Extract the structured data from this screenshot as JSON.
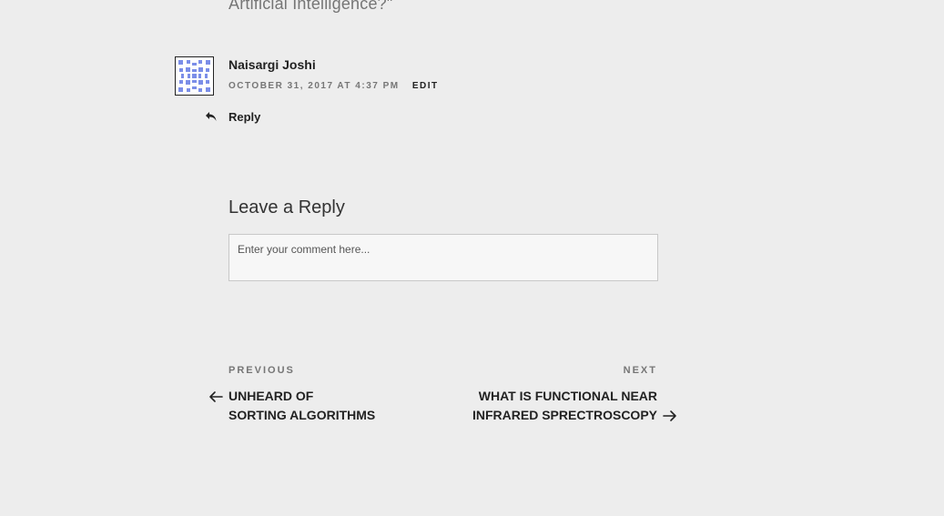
{
  "previous_post_title_tail": "Artificial Intelligence?\"",
  "comment": {
    "author": "Naisargi Joshi",
    "date": "OCTOBER 31, 2017 AT 4:37 PM",
    "edit_label": "EDIT",
    "reply_label": "Reply",
    "avatar_icon": "identicon-avatar",
    "avatar_color": "#7b8ee8"
  },
  "reply_form": {
    "heading": "Leave a Reply",
    "placeholder": "Enter your comment here..."
  },
  "post_navigation": {
    "previous": {
      "label": "PREVIOUS",
      "title_line1": "UNHEARD OF",
      "title_line2": "SORTING ALGORITHMS",
      "icon": "arrow-left-icon"
    },
    "next": {
      "label": "NEXT",
      "title_line1": "WHAT IS FUNCTIONAL NEAR",
      "title_line2": "INFRARED SPRECTROSCOPY",
      "icon": "arrow-right-icon"
    }
  }
}
